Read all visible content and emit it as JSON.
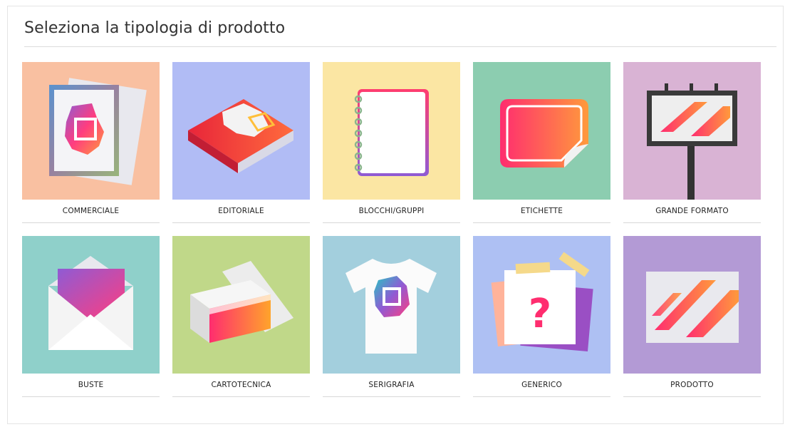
{
  "page": {
    "title": "Seleziona la tipologia di prodotto"
  },
  "products": [
    {
      "label": "COMMERCIALE",
      "icon": "commercial-print-icon",
      "bg": "#f9c0a1"
    },
    {
      "label": "EDITORIALE",
      "icon": "book-icon",
      "bg": "#b1bcf5"
    },
    {
      "label": "BLOCCHI/GRUPPI",
      "icon": "notepad-icon",
      "bg": "#fbe6a3"
    },
    {
      "label": "ETICHETTE",
      "icon": "sticker-label-icon",
      "bg": "#8ccdb0"
    },
    {
      "label": "GRANDE FORMATO",
      "icon": "billboard-icon",
      "bg": "#d9b3d4"
    },
    {
      "label": "BUSTE",
      "icon": "envelope-icon",
      "bg": "#8fd0ca"
    },
    {
      "label": "CARTOTECNICA",
      "icon": "box-icon",
      "bg": "#c0d889"
    },
    {
      "label": "SERIGRAFIA",
      "icon": "tshirt-icon",
      "bg": "#a3cfdd"
    },
    {
      "label": "GENERICO",
      "icon": "question-note-icon",
      "bg": "#aec0f3"
    },
    {
      "label": "PRODOTTO",
      "icon": "product-panel-icon",
      "bg": "#b39ad5"
    }
  ],
  "colors": {
    "gradient_start": "#ff2d6f",
    "gradient_end": "#ff9a3c",
    "accent_teal": "#1ad6c8"
  }
}
